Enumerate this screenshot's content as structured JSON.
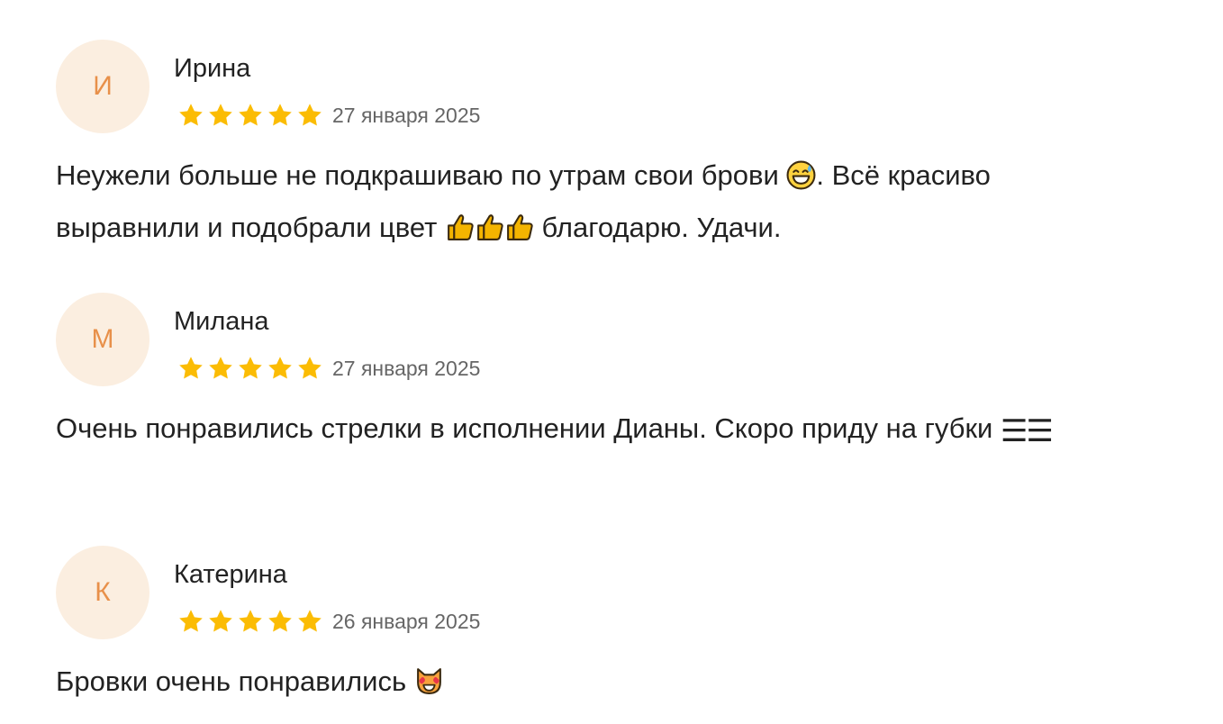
{
  "reviews": [
    {
      "initial": "И",
      "name": "Ирина",
      "date": "27 января 2025",
      "rating": 5,
      "text_part1": "Неужели больше не подкрашиваю по утрам свои брови ",
      "text_part2": ". Всё красиво выравнили и подобрали цвет ",
      "text_part3": " благодарю. Удачи."
    },
    {
      "initial": "М",
      "name": "Милана",
      "date": "27 января 2025",
      "rating": 5,
      "text_part1": "Очень понравились стрелки в исполнении Дианы. Скоро приду на губки ",
      "emoji_text": "☰☰"
    },
    {
      "initial": "К",
      "name": "Катерина",
      "date": "26 января 2025",
      "rating": 5,
      "text_part1": "Бровки очень понравились "
    }
  ],
  "colors": {
    "star": "#fbbc04",
    "avatar_bg": "#fbeee0",
    "avatar_text": "#e8904a",
    "date": "#666666",
    "text": "#222222"
  },
  "icons": {
    "star": "star-icon",
    "sweat_smile": "grinning-sweat-emoji-icon",
    "thumbs_up": "thumbs-up-emoji-icon",
    "cat_heart_eyes": "heart-eyes-cat-emoji-icon"
  }
}
